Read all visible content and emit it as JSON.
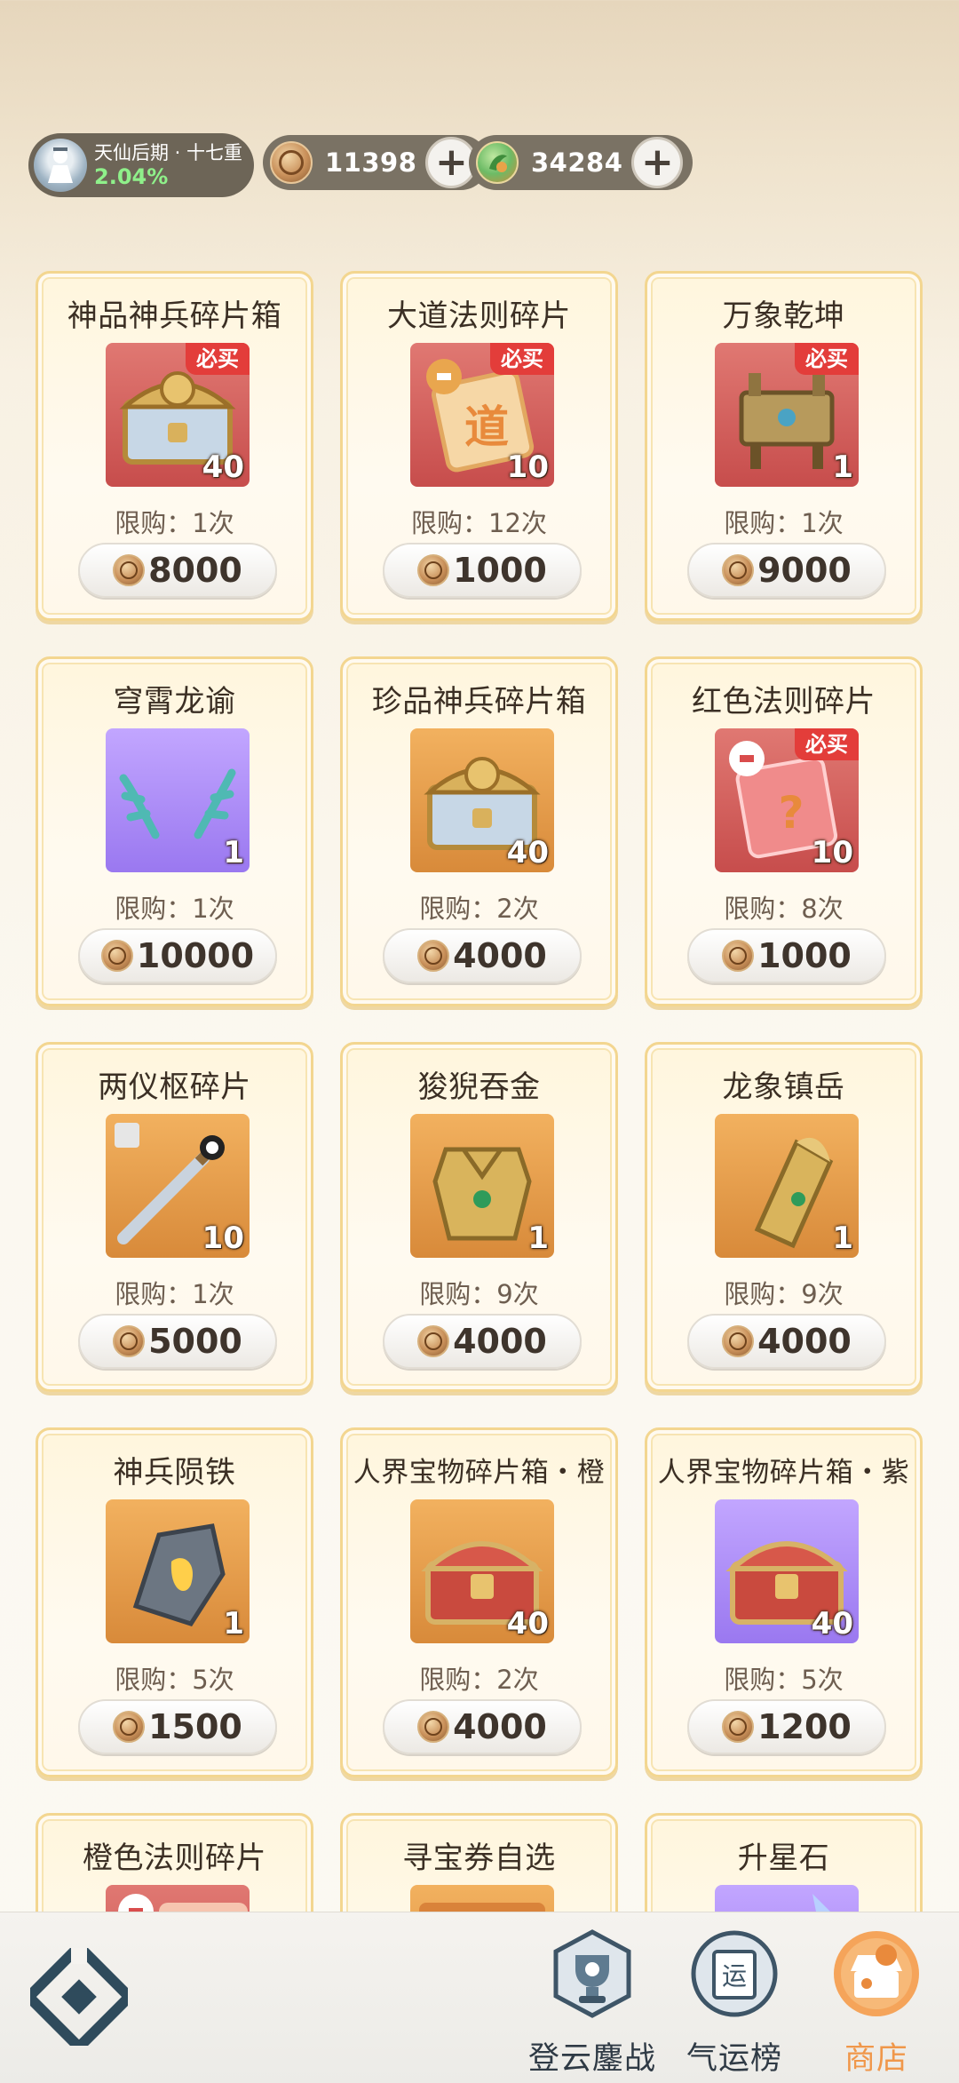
{
  "status": {
    "realm_name": "天仙后期 · 十七重",
    "realm_progress": "2.04%",
    "coins": "11398",
    "jade": "34284",
    "plus_symbol": "+"
  },
  "shop_items": [
    {
      "title": "神品神兵碎片箱",
      "badge": "必买",
      "qty": "40",
      "limit": "限购：1次",
      "price": "8000",
      "bg": "red",
      "icon": "dragon-treasure-chest-icon"
    },
    {
      "title": "大道法则碎片",
      "badge": "必买",
      "qty": "10",
      "limit": "限购：12次",
      "price": "1000",
      "bg": "red",
      "icon": "dao-rule-fragment-icon",
      "glyph": "道"
    },
    {
      "title": "万象乾坤",
      "badge": "必买",
      "qty": "1",
      "limit": "限购：1次",
      "price": "9000",
      "bg": "red",
      "icon": "bronze-cauldron-icon"
    },
    {
      "title": "穹霄龙谕",
      "badge": "",
      "qty": "1",
      "limit": "限购：1次",
      "price": "10000",
      "bg": "purple",
      "icon": "dragon-antlers-icon"
    },
    {
      "title": "珍品神兵碎片箱",
      "badge": "",
      "qty": "40",
      "limit": "限购：2次",
      "price": "4000",
      "bg": "orange",
      "icon": "dragon-treasure-chest-icon"
    },
    {
      "title": "红色法则碎片",
      "badge": "必买",
      "qty": "10",
      "limit": "限购：8次",
      "price": "1000",
      "bg": "red",
      "icon": "mystery-rule-fragment-icon",
      "glyph": "?"
    },
    {
      "title": "两仪枢碎片",
      "badge": "",
      "qty": "10",
      "limit": "限购：1次",
      "price": "5000",
      "bg": "orange",
      "icon": "taiji-sword-icon"
    },
    {
      "title": "狻猊吞金",
      "badge": "",
      "qty": "1",
      "limit": "限购：9次",
      "price": "4000",
      "bg": "orange",
      "icon": "golden-armor-icon"
    },
    {
      "title": "龙象镇岳",
      "badge": "",
      "qty": "1",
      "limit": "限购：9次",
      "price": "4000",
      "bg": "orange",
      "icon": "golden-bracer-icon"
    },
    {
      "title": "神兵陨铁",
      "badge": "",
      "qty": "1",
      "limit": "限购：5次",
      "price": "1500",
      "bg": "orange",
      "icon": "meteorite-iron-icon"
    },
    {
      "title": "人界宝物碎片箱・橙",
      "badge": "",
      "qty": "40",
      "limit": "限购：2次",
      "price": "4000",
      "bg": "orange",
      "icon": "red-treasure-chest-icon"
    },
    {
      "title": "人界宝物碎片箱・紫",
      "badge": "",
      "qty": "40",
      "limit": "限购：5次",
      "price": "1200",
      "bg": "purple",
      "icon": "red-treasure-chest-icon"
    },
    {
      "title": "橙色法则碎片",
      "badge": "",
      "qty": "",
      "limit": "",
      "price": "",
      "bg": "red",
      "icon": "orange-rule-fragment-icon"
    },
    {
      "title": "寻宝券自选",
      "badge": "",
      "qty": "",
      "limit": "",
      "price": "",
      "bg": "orange",
      "icon": "treasure-ticket-icon"
    },
    {
      "title": "升星石",
      "badge": "",
      "qty": "",
      "limit": "",
      "price": "",
      "bg": "purple",
      "icon": "star-stone-icon"
    }
  ],
  "nav": {
    "items": [
      {
        "label": "登云鏖战",
        "icon": "trophy-icon"
      },
      {
        "label": "气运榜",
        "icon": "fortune-scroll-icon",
        "glyph": "运"
      },
      {
        "label": "商店",
        "icon": "shop-icon"
      }
    ],
    "active": "商店",
    "active_color": "#f0974a"
  }
}
